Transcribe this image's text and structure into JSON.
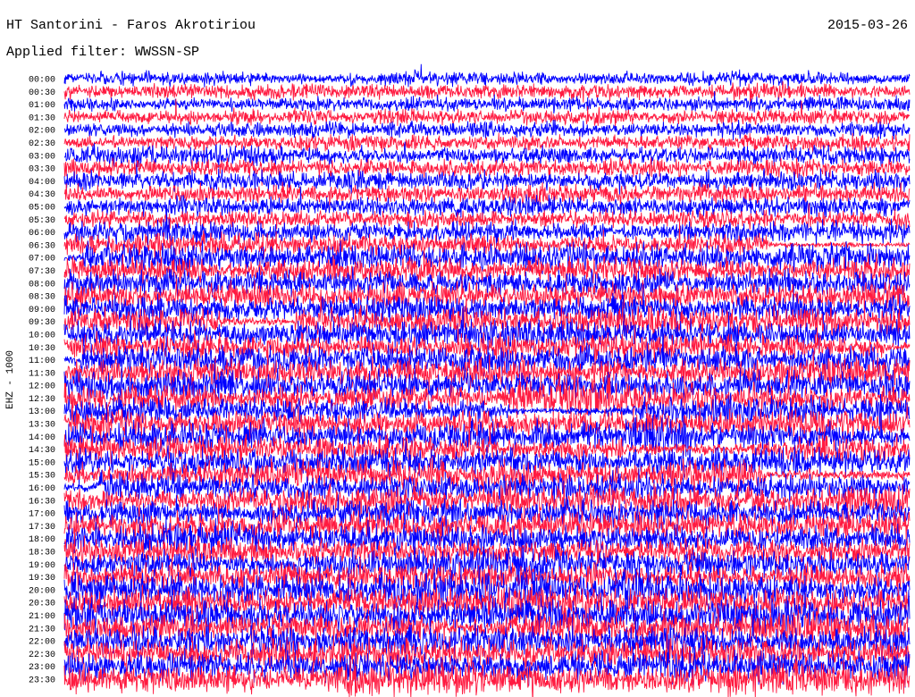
{
  "chart_data": {
    "type": "line",
    "title": "HT Santorini - Faros Akrotiriou",
    "date": "2015-03-26",
    "subtitle": "Applied filter: WWSSN-SP",
    "xlabel": "",
    "ylabel": "EHZ - 1000",
    "grid": false,
    "background": "#ffffff",
    "traces": [
      {
        "label": "00:00",
        "color": "#0000ff"
      },
      {
        "label": "00:30",
        "color": "#ff1a40"
      },
      {
        "label": "01:00",
        "color": "#0000ff"
      },
      {
        "label": "01:30",
        "color": "#ff1a40"
      },
      {
        "label": "02:00",
        "color": "#0000ff"
      },
      {
        "label": "02:30",
        "color": "#ff1a40"
      },
      {
        "label": "03:00",
        "color": "#0000ff"
      },
      {
        "label": "03:30",
        "color": "#ff1a40"
      },
      {
        "label": "04:00",
        "color": "#0000ff"
      },
      {
        "label": "04:30",
        "color": "#ff1a40"
      },
      {
        "label": "05:00",
        "color": "#0000ff"
      },
      {
        "label": "05:30",
        "color": "#ff1a40"
      },
      {
        "label": "06:00",
        "color": "#0000ff"
      },
      {
        "label": "06:30",
        "color": "#ff1a40"
      },
      {
        "label": "07:00",
        "color": "#0000ff"
      },
      {
        "label": "07:30",
        "color": "#ff1a40"
      },
      {
        "label": "08:00",
        "color": "#0000ff"
      },
      {
        "label": "08:30",
        "color": "#ff1a40"
      },
      {
        "label": "09:00",
        "color": "#0000ff"
      },
      {
        "label": "09:30",
        "color": "#ff1a40"
      },
      {
        "label": "10:00",
        "color": "#0000ff"
      },
      {
        "label": "10:30",
        "color": "#ff1a40"
      },
      {
        "label": "11:00",
        "color": "#0000ff"
      },
      {
        "label": "11:30",
        "color": "#ff1a40"
      },
      {
        "label": "12:00",
        "color": "#0000ff"
      },
      {
        "label": "12:30",
        "color": "#ff1a40"
      },
      {
        "label": "13:00",
        "color": "#0000ff"
      },
      {
        "label": "13:30",
        "color": "#ff1a40"
      },
      {
        "label": "14:00",
        "color": "#0000ff"
      },
      {
        "label": "14:30",
        "color": "#ff1a40"
      },
      {
        "label": "15:00",
        "color": "#0000ff"
      },
      {
        "label": "15:30",
        "color": "#ff1a40"
      },
      {
        "label": "16:00",
        "color": "#0000ff"
      },
      {
        "label": "16:30",
        "color": "#ff1a40"
      },
      {
        "label": "17:00",
        "color": "#0000ff"
      },
      {
        "label": "17:30",
        "color": "#ff1a40"
      },
      {
        "label": "18:00",
        "color": "#0000ff"
      },
      {
        "label": "18:30",
        "color": "#ff1a40"
      },
      {
        "label": "19:00",
        "color": "#0000ff"
      },
      {
        "label": "19:30",
        "color": "#ff1a40"
      },
      {
        "label": "20:00",
        "color": "#0000ff"
      },
      {
        "label": "20:30",
        "color": "#ff1a40"
      },
      {
        "label": "21:00",
        "color": "#0000ff"
      },
      {
        "label": "21:30",
        "color": "#ff1a40"
      },
      {
        "label": "22:00",
        "color": "#0000ff"
      },
      {
        "label": "22:30",
        "color": "#ff1a40"
      },
      {
        "label": "23:00",
        "color": "#0000ff"
      },
      {
        "label": "23:30",
        "color": "#ff1a40"
      }
    ]
  }
}
